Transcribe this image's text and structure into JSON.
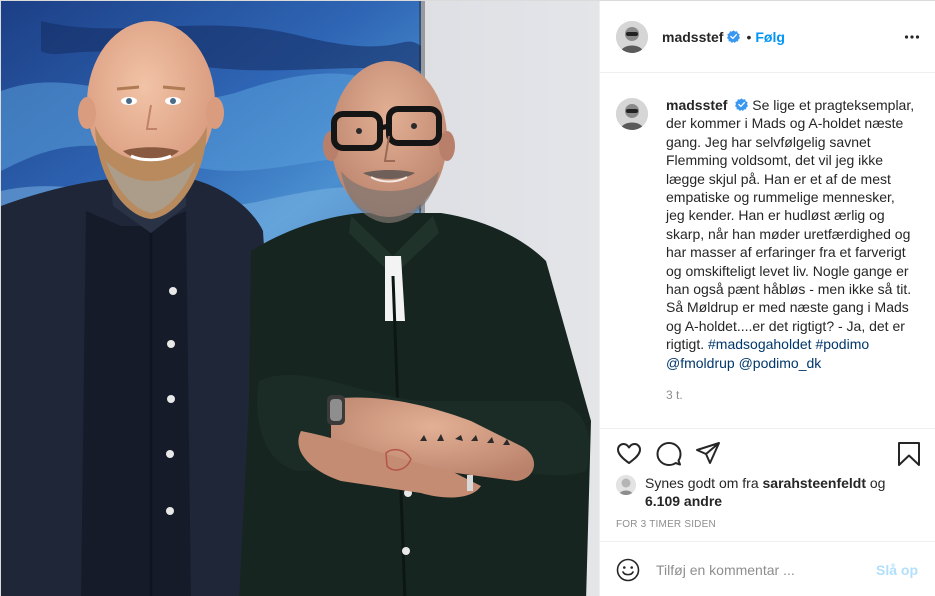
{
  "post": {
    "username": "madsstef",
    "dot": "•",
    "follow_label": "Følg",
    "caption": {
      "username": "madsstef",
      "text": "Se lige et pragteksemplar, der kommer i Mads og A-holdet næste gang. Jeg har selvfølgelig savnet Flemming voldsomt, det vil jeg ikke lægge skjul på. Han er et af de mest empatiske og rummelige mennesker, jeg kender. Han er hudløst ærlig og skarp, når han møder uretfærdighed og har masser af erfaringer fra et farverigt og omskifteligt levet liv. Nogle gange er han også pænt håbløs - men ikke så tit. Så Møldrup er med næste gang i Mads og A-holdet....er det rigtigt? - Ja, det er rigtigt.",
      "hashtag_madsogaholdet": "#madsogaholdet",
      "hashtag_podimo": "#podimo",
      "mention_fmoldrup": "@fmoldrup",
      "mention_podimo_dk": "@podimo_dk",
      "time_ago": "3 t."
    },
    "likes": {
      "prefix": "Synes godt om fra",
      "liker": "sarahsteenfeldt",
      "conjunction": "og",
      "others": "6.109 andre"
    },
    "timestamp": "FOR 3 TIMER SIDEN",
    "comment": {
      "placeholder": "Tilføj en kommentar ...",
      "post_label": "Slå op"
    }
  },
  "icons": {
    "verified": "verified-badge-icon",
    "more": "more-options-icon",
    "like": "heart-icon",
    "comment": "comment-bubble-icon",
    "share": "paper-plane-icon",
    "save": "bookmark-icon",
    "emoji": "smiley-icon"
  },
  "colors": {
    "link_blue": "#0095f6",
    "tag_blue": "#00376b",
    "verified_blue": "#3897f0",
    "muted": "#8e8e8e",
    "post_disabled": "#b2dffc"
  }
}
